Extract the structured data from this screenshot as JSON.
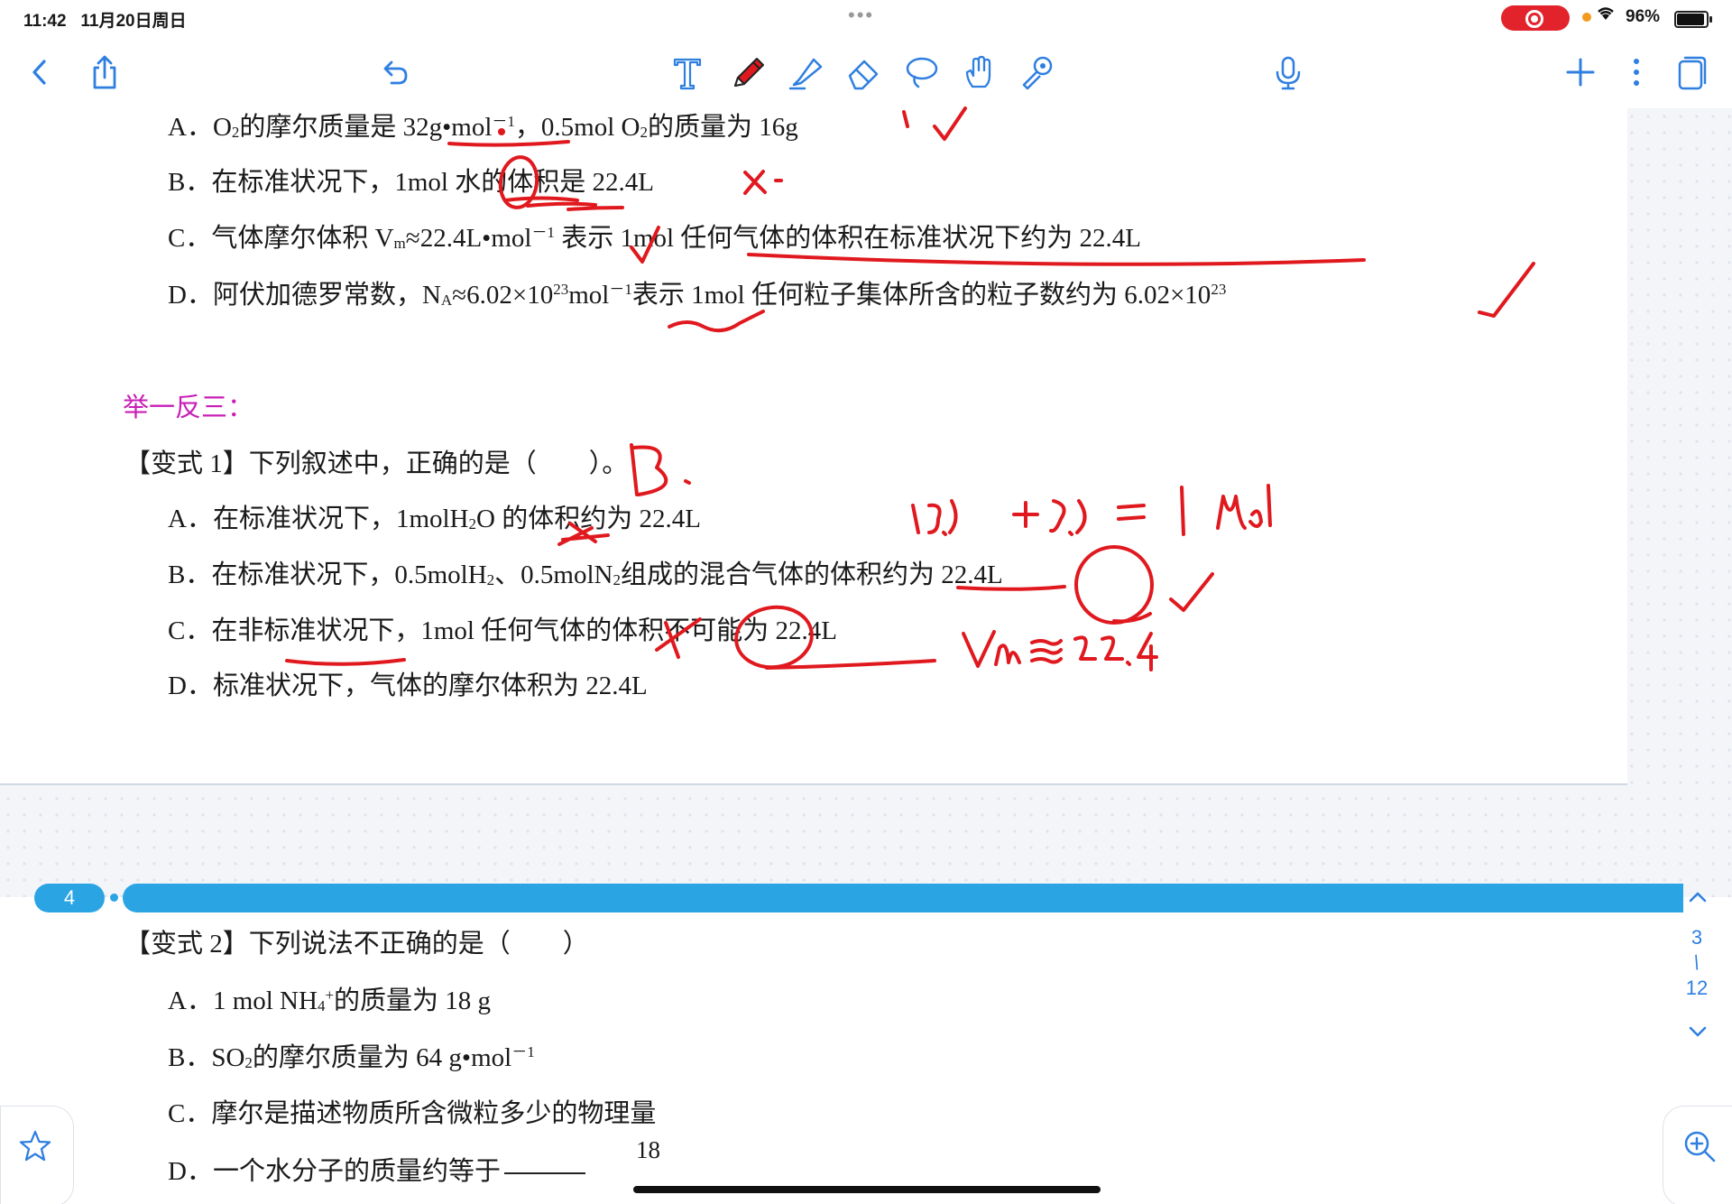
{
  "status_bar": {
    "time": "11:42",
    "date": "11月20日周日",
    "battery": "96%"
  },
  "toolbar": {
    "icons": [
      "chevron-left-icon",
      "share-icon",
      "undo-icon",
      "text-tool-icon",
      "pen-icon",
      "highlighter-icon",
      "eraser-icon",
      "lasso-icon",
      "hand-icon",
      "laser-pointer-icon",
      "microphone-icon",
      "add-icon",
      "more-icon",
      "pages-icon"
    ],
    "accent_color": "#2f7fe0",
    "pen_color": "#e0191f"
  },
  "page1": {
    "q_prev": {
      "a": {
        "prefix": "A．O",
        "sub1": "2",
        "mid": "的摩尔质量是 32g•mol",
        "sup1": "－1",
        "mid2": "，0.5mol O",
        "sub2": "2",
        "end": "的质量为 16g"
      },
      "b": "B．在标准状况下，1mol 水的体积是 22.4L",
      "c": {
        "text": "C．气体摩尔体积 V",
        "sub": "m",
        "mid": "≈22.4L•mol",
        "sup": "－1",
        "end": " 表示 1mol 任何气体的体积在标准状况下约为 22.4L"
      },
      "d": {
        "text": "D．阿伏加德罗常数，N",
        "sub": "A",
        "mid": "≈6.02×10",
        "sup": "23",
        "mid2": "mol",
        "sup2": "－1",
        "end": "表示 1mol 任何粒子集体所含的粒子数约为 6.02×10",
        "sup3": "23"
      }
    },
    "section_title": "举一反三：",
    "variant1": {
      "stem": "【变式 1】下列叙述中，正确的是（　　）。",
      "a": {
        "prefix": "A．在标准状况下，1molH",
        "sub": "2",
        "end": "O 的体积约为 22.4L"
      },
      "b": {
        "prefix": "B．在标准状况下，0.5molH",
        "sub1": "2",
        "mid": "、0.5molN",
        "sub2": "2",
        "end": "组成的混合气体的体积约为 22.4L"
      },
      "c": "C．在非标准状况下，1mol 任何气体的体积不可能为 22.4L",
      "d": "D．标准状况下，气体的摩尔体积为 22.4L"
    }
  },
  "handwriting": {
    "answer1": "B",
    "calc": "0.5　+0.5 = 1 mol",
    "vm_note": "Vm ≈ 22.4"
  },
  "page_indicator": {
    "current_badge": "4",
    "page_num": "3",
    "separator": "/",
    "total": "12"
  },
  "page2": {
    "variant2": {
      "stem": "【变式 2】下列说法不正确的是（　　）",
      "a": {
        "prefix": "A．1 mol NH",
        "sub": "4",
        "sup": "+",
        "end": "的质量为 18 g"
      },
      "b": {
        "prefix": "B．SO",
        "sub": "2",
        "mid": "的摩尔质量为 64 g•mol",
        "sup": "－1"
      },
      "c": "C．摩尔是描述物质所含微粒多少的物理量",
      "d": "D．一个水分子的质量约等于",
      "d_fraction_top": "18"
    }
  }
}
